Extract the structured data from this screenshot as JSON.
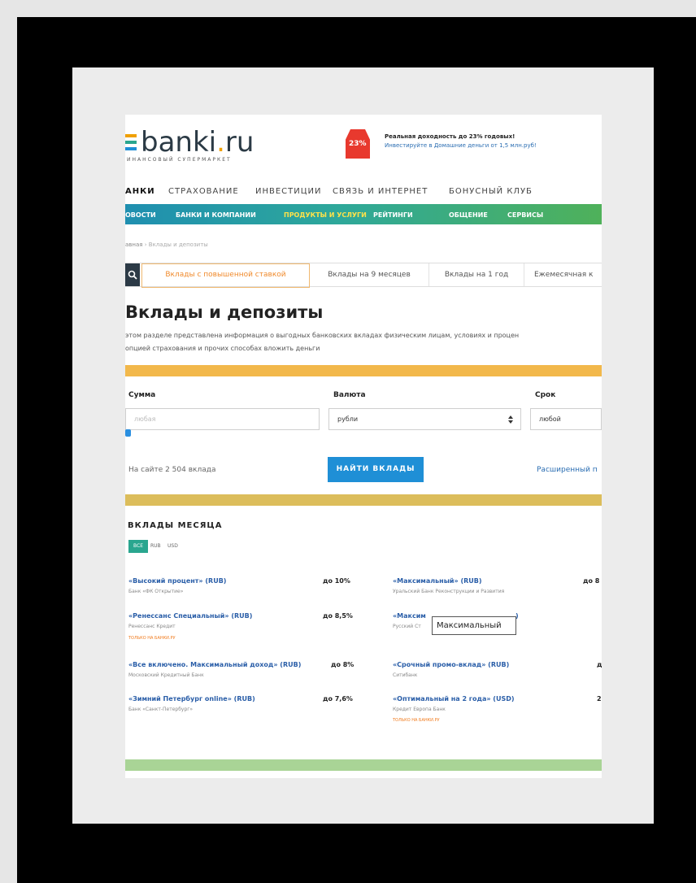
{
  "logo": {
    "name_main": "banki",
    "name_dot": ".",
    "name_tld": "ru",
    "tagline": "ИНАНСОВЫЙ СУПЕРМАРКЕТ"
  },
  "promo": {
    "badge": "23%",
    "title": "Реальная доходность до 23% годовых!",
    "subtitle": "Инвестируйте в Домашние деньги от 1,5 млн.руб!"
  },
  "main_nav": [
    "АНКИ",
    "СТРАХОВАНИЕ",
    "ИНВЕСТИЦИИ",
    "СВЯЗЬ И ИНТЕРНЕТ",
    "БОНУСНЫЙ КЛУБ"
  ],
  "sub_nav": [
    "ОВОСТИ",
    "БАНКИ И КОМПАНИИ",
    "ПРОДУКТЫ И УСЛУГИ",
    "РЕЙТИНГИ",
    "ОБЩЕНИЕ",
    "СЕРВИСЫ"
  ],
  "breadcrumb": {
    "home": "авная",
    "separator": "›",
    "current": "Вклады и депозиты"
  },
  "tabs": [
    "Вклады с повышенной ставкой",
    "Вклады на 9 месяцев",
    "Вклады на 1 год",
    "Ежемесячная к"
  ],
  "page": {
    "title": "Вклады и депозиты",
    "desc_line1": "этом разделе представлена информация о выгодных банковских вкладах физическим лицам, условиях и процен",
    "desc_line2": "опцией страхования и прочих способах вложить деньги"
  },
  "form": {
    "sum_label": "Сумма",
    "sum_placeholder": "любая",
    "currency_label": "Валюта",
    "currency_value": "рубли",
    "term_label": "Срок",
    "term_value": "любой",
    "count_text": "На сайте 2 504 вклада",
    "find_button": "НАЙТИ ВКЛАДЫ",
    "advanced_link": "Расширенный п"
  },
  "month": {
    "title": "ВКЛАДЫ МЕСЯЦА",
    "currency_tabs": [
      "ВСЕ",
      "RUB",
      "USD"
    ]
  },
  "deposits_left": [
    {
      "name": "«Высокий процент» (RUB)",
      "bank": "Банк «ФК Открытие»",
      "rate": "до 10%",
      "only": ""
    },
    {
      "name": "«Ренессанс Специальный» (RUB)",
      "bank": "Ренессанс Кредит",
      "rate": "до 8,5%",
      "only": "ТОЛЬКО НА БАНКИ.РУ"
    },
    {
      "name": "«Все включено. Максимальный доход» (RUB)",
      "bank": "Московский Кредитный Банк",
      "rate": "до 8%",
      "only": ""
    },
    {
      "name": "«Зимний Петербург online» (RUB)",
      "bank": "Банк «Санкт-Петербург»",
      "rate": "до 7,6%",
      "only": ""
    }
  ],
  "deposits_right": [
    {
      "name": "«Максимальный» (RUB)",
      "bank": "Уральский Банк Реконструкции и Развития",
      "rate": "до 8",
      "only": ""
    },
    {
      "name": "«Максим",
      "bank": "Русский Ст",
      "rate": "",
      "only": "",
      "tail": ")"
    },
    {
      "name": "«Срочный промо-вклад» (RUB)",
      "bank": "Ситибанк",
      "rate": "д",
      "only": ""
    },
    {
      "name": "«Оптимальный на 2 года» (USD)",
      "bank": "Кредит Европа Банк",
      "rate": "2",
      "only": "ТОЛЬКО НА БАНКИ.РУ"
    }
  ],
  "tooltip": "Максимальный",
  "colors": {
    "accent_orange": "#f08a2c",
    "nav_blue": "#1f8fb0",
    "nav_green": "#4fb15a",
    "button_blue": "#1f8fd6",
    "link_blue": "#2a5ea8"
  }
}
